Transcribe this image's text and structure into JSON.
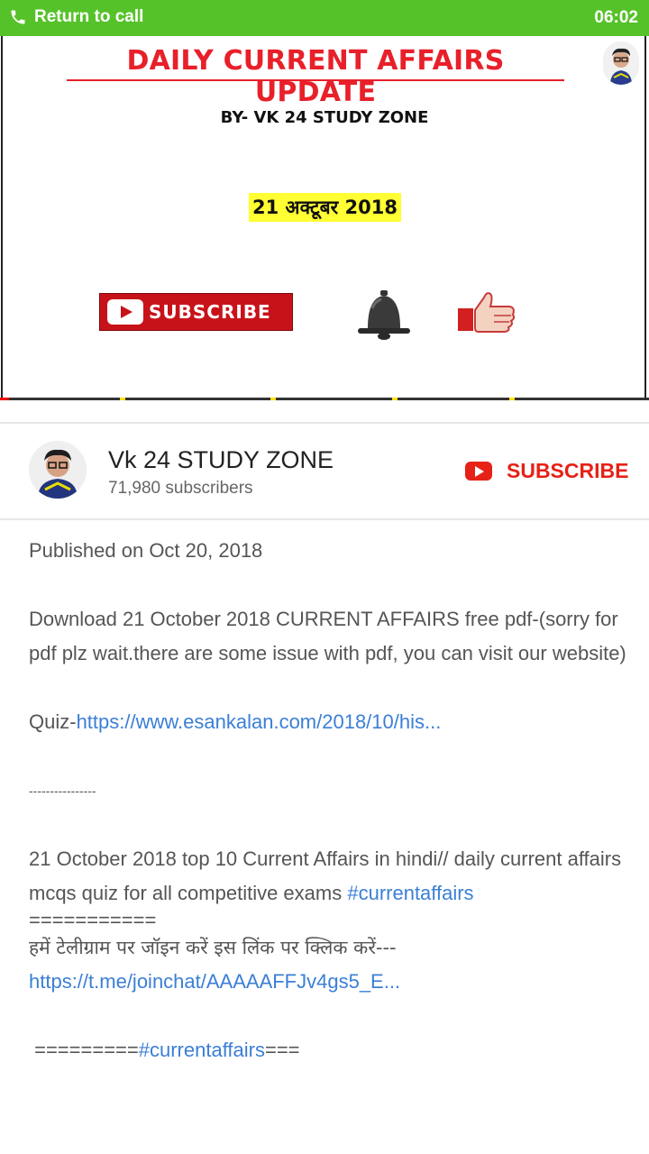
{
  "call_bar": {
    "label": "Return to call",
    "time": "06:02"
  },
  "video": {
    "title": "DAILY CURRENT AFFAIRS UPDATE",
    "byline": "BY- VK 24 STUDY ZONE",
    "date": "21 अक्टूबर 2018",
    "subscribe_label": "SUBSCRIBE",
    "icons": [
      "bell-icon",
      "thumbs-up-icon"
    ]
  },
  "channel": {
    "name": "Vk 24 STUDY ZONE",
    "subscribers": "71,980 subscribers",
    "subscribe_label": "SUBSCRIBE"
  },
  "description": {
    "published": "Published on Oct 20, 2018",
    "download": "Download 21 October 2018 CURRENT AFFAIRS free pdf-(sorry for pdf plz wait.there are some issue with pdf, you can visit our website)",
    "quiz_prefix": "Quiz-",
    "quiz_link": "https://www.esankalan.com/2018/10/his...",
    "dashes": "----------------",
    "summary": "21 October 2018 top 10 Current Affairs in hindi// daily current affairs mcqs quiz for all competitive exams ",
    "hashtag1": "#currentaffairs",
    "equals": "===========",
    "telegram_text": "हमें टेलीग्राम पर जॉइन करें इस लिंक पर क्लिक करें---  ",
    "telegram_link": "https://t.me/joinchat/AAAAAFFJv4gs5_E...",
    "footer_prefix": " =========",
    "hashtag2": "#currentaffairs",
    "footer_suffix": "==="
  },
  "colors": {
    "call_bar": "#56c22a",
    "accent_red": "#e62117",
    "link": "#3b7fd6"
  }
}
